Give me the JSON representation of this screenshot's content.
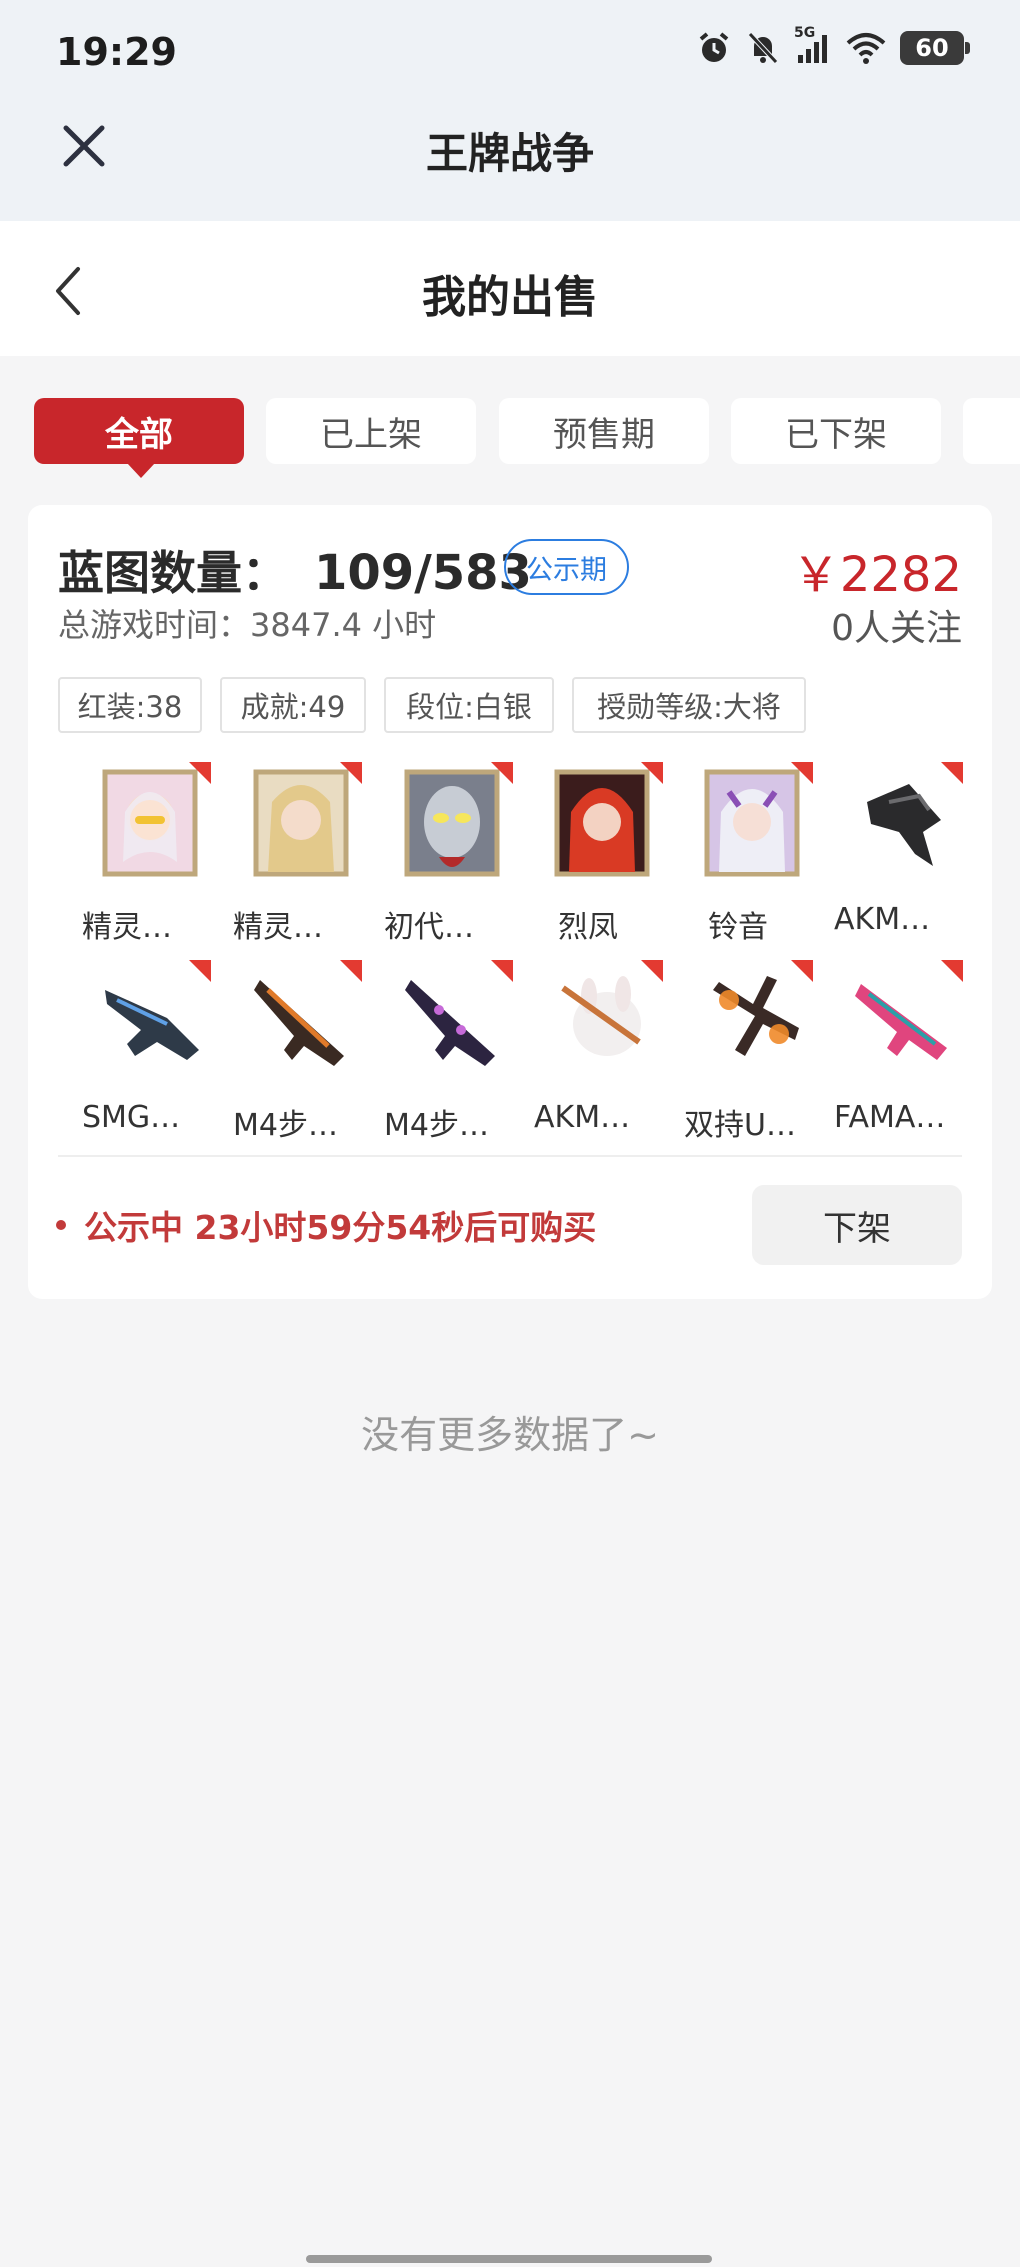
{
  "status_bar": {
    "time": "19:29",
    "network": "5G",
    "battery": "60"
  },
  "app_bar": {
    "title": "王牌战争"
  },
  "page": {
    "title": "我的出售"
  },
  "tabs": [
    {
      "label": "全部",
      "active": true
    },
    {
      "label": "已上架",
      "active": false
    },
    {
      "label": "预售期",
      "active": false
    },
    {
      "label": "已下架",
      "active": false
    },
    {
      "label": "",
      "active": false
    }
  ],
  "listing": {
    "blueprint_label": "蓝图数量：",
    "blueprint_value": "109/583",
    "badge": "公示期",
    "price": "￥2282",
    "followers": "0人关注",
    "playtime": "总游戏时间：3847.4 小时",
    "tags": [
      "红装:38",
      "成就:49",
      "段位:白银",
      "授勋等级:大将"
    ],
    "items_row1": [
      {
        "label": "精灵…",
        "icon": "character-portrait-icon"
      },
      {
        "label": "精灵…",
        "icon": "character-portrait-icon"
      },
      {
        "label": "初代…",
        "icon": "character-portrait-icon"
      },
      {
        "label": "烈凤",
        "icon": "character-portrait-icon"
      },
      {
        "label": "铃音",
        "icon": "character-portrait-icon"
      },
      {
        "label": "AKM…",
        "icon": "weapon-skin-icon"
      }
    ],
    "items_row2": [
      {
        "label": "SMG…",
        "icon": "weapon-skin-icon"
      },
      {
        "label": "M4步…",
        "icon": "weapon-skin-icon"
      },
      {
        "label": "M4步…",
        "icon": "weapon-skin-icon"
      },
      {
        "label": "AKM…",
        "icon": "weapon-skin-icon"
      },
      {
        "label": "双持U…",
        "icon": "weapon-skin-icon"
      },
      {
        "label": "FAMA…",
        "icon": "weapon-skin-icon"
      }
    ],
    "notice": "公示中 23小时59分54秒后可购买",
    "delist_button": "下架"
  },
  "footer": {
    "no_more": "没有更多数据了~"
  },
  "colors": {
    "accent_red": "#c8262b",
    "badge_blue": "#2c7de0",
    "frame_gold": "#bea77b"
  }
}
